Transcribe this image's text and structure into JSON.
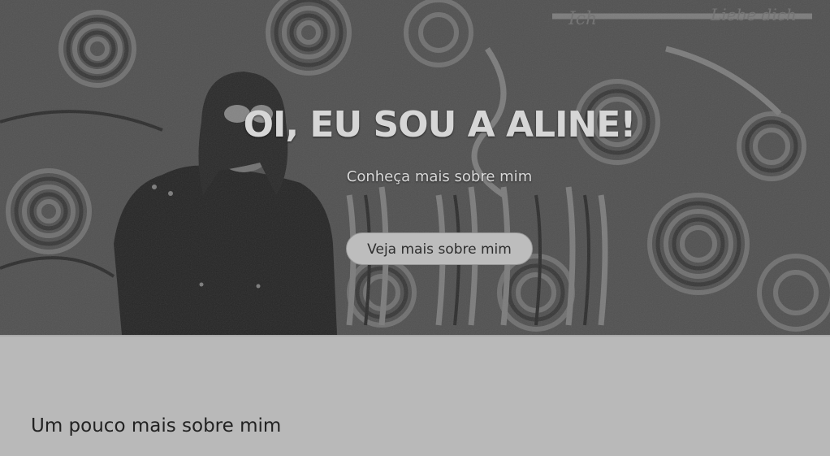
{
  "hero": {
    "title": "OI, EU SOU A ALINE!",
    "subtitle": "Conheça mais sobre mim",
    "button_label": "Veja mais sobre mim",
    "background_image": "graffiti-wall-photo-with-woman"
  },
  "about": {
    "heading": "Um pouco mais sobre mim"
  },
  "colors": {
    "page_background": "#b9b9b9",
    "hero_text": "#d6d6d6",
    "button_background": "#bdbdbd",
    "heading_text": "#222222"
  }
}
